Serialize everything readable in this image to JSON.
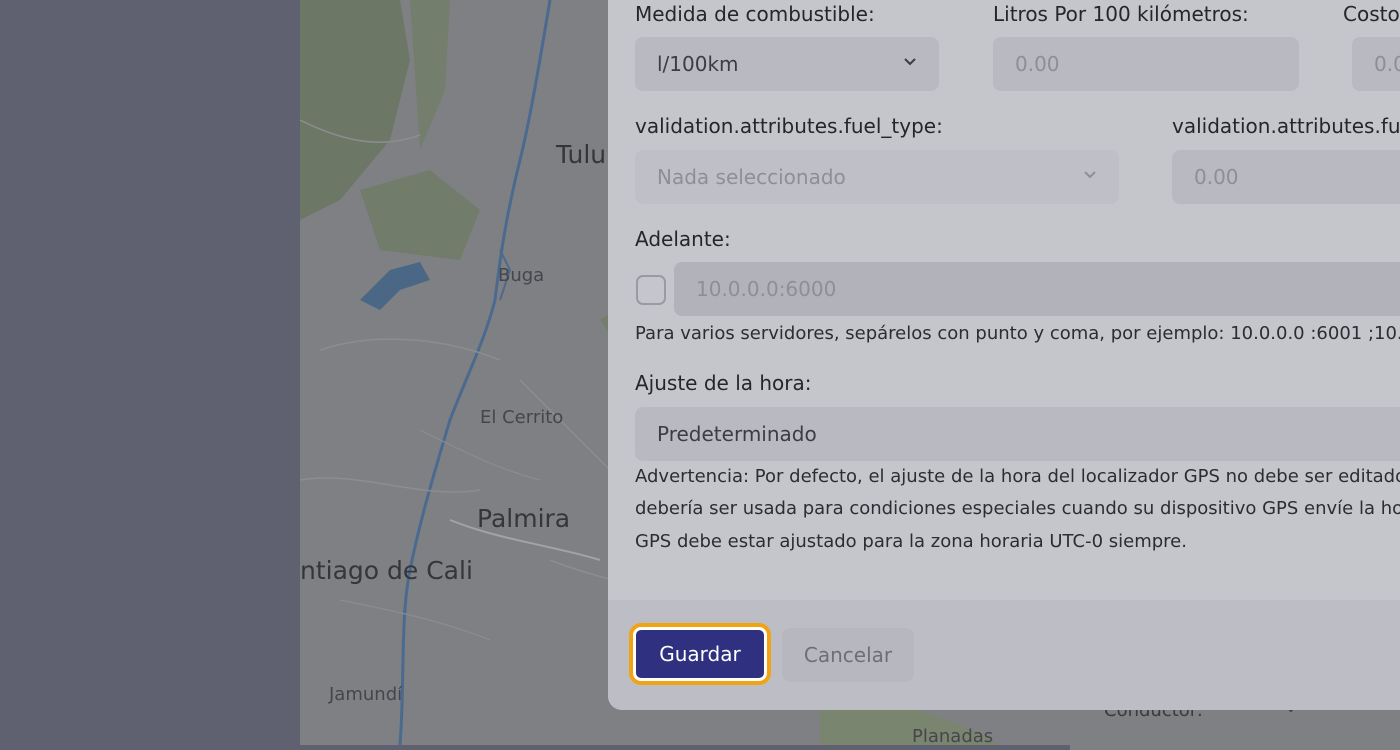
{
  "map": {
    "labels": {
      "tulua": "Tulu",
      "buga": "Buga",
      "el_cerrito": "El Cerrito",
      "palmira": "Palmira",
      "cali": "ntiago de Cali",
      "jamundi": "Jamundí",
      "planadas": "Planadas"
    }
  },
  "background_panel": {
    "field_label": "Conductor:"
  },
  "form": {
    "fuel_measure": {
      "label": "Medida de combustible:",
      "value": "l/100km"
    },
    "liters_per_100km": {
      "label": "Litros Por 100 kilómetros:",
      "placeholder": "0.00"
    },
    "cost": {
      "label": "Costo",
      "placeholder": "0.0"
    },
    "fuel_type": {
      "label": "validation.attributes.fuel_type:",
      "value": "Nada seleccionado"
    },
    "fuel_price": {
      "label": "validation.attributes.fu",
      "placeholder": "0.00"
    },
    "forward": {
      "label": "Adelante:",
      "placeholder": "10.0.0.0:6000",
      "help": "Para varios servidores, sepárelos con punto y coma, por ejemplo: 10.0.0.0 :6001 ;10."
    },
    "time_adjust": {
      "label": "Ajuste de la hora:",
      "value": "Predeterminado",
      "warning_lines": [
        "Advertencia: Por defecto, el ajuste de la hora del localizador GPS no debe ser editado",
        "debería ser usada para condiciones especiales cuando su dispositivo GPS envíe la hor",
        "GPS debe estar ajustado para la zona horaria UTC-0 siempre."
      ]
    }
  },
  "footer": {
    "save_label": "Guardar",
    "cancel_label": "Cancelar"
  },
  "colors": {
    "primary": "#2f3180",
    "focus_ring": "#f0a414"
  }
}
